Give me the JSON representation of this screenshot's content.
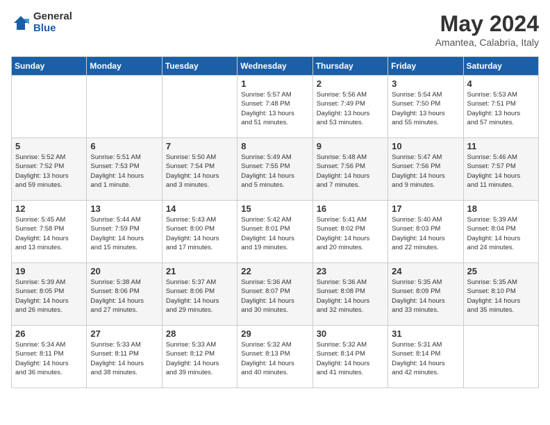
{
  "header": {
    "logo_general": "General",
    "logo_blue": "Blue",
    "title": "May 2024",
    "location": "Amantea, Calabria, Italy"
  },
  "days_of_week": [
    "Sunday",
    "Monday",
    "Tuesday",
    "Wednesday",
    "Thursday",
    "Friday",
    "Saturday"
  ],
  "weeks": [
    [
      {
        "num": "",
        "info": ""
      },
      {
        "num": "",
        "info": ""
      },
      {
        "num": "",
        "info": ""
      },
      {
        "num": "1",
        "info": "Sunrise: 5:57 AM\nSunset: 7:48 PM\nDaylight: 13 hours\nand 51 minutes."
      },
      {
        "num": "2",
        "info": "Sunrise: 5:56 AM\nSunset: 7:49 PM\nDaylight: 13 hours\nand 53 minutes."
      },
      {
        "num": "3",
        "info": "Sunrise: 5:54 AM\nSunset: 7:50 PM\nDaylight: 13 hours\nand 55 minutes."
      },
      {
        "num": "4",
        "info": "Sunrise: 5:53 AM\nSunset: 7:51 PM\nDaylight: 13 hours\nand 57 minutes."
      }
    ],
    [
      {
        "num": "5",
        "info": "Sunrise: 5:52 AM\nSunset: 7:52 PM\nDaylight: 13 hours\nand 59 minutes."
      },
      {
        "num": "6",
        "info": "Sunrise: 5:51 AM\nSunset: 7:53 PM\nDaylight: 14 hours\nand 1 minute."
      },
      {
        "num": "7",
        "info": "Sunrise: 5:50 AM\nSunset: 7:54 PM\nDaylight: 14 hours\nand 3 minutes."
      },
      {
        "num": "8",
        "info": "Sunrise: 5:49 AM\nSunset: 7:55 PM\nDaylight: 14 hours\nand 5 minutes."
      },
      {
        "num": "9",
        "info": "Sunrise: 5:48 AM\nSunset: 7:56 PM\nDaylight: 14 hours\nand 7 minutes."
      },
      {
        "num": "10",
        "info": "Sunrise: 5:47 AM\nSunset: 7:56 PM\nDaylight: 14 hours\nand 9 minutes."
      },
      {
        "num": "11",
        "info": "Sunrise: 5:46 AM\nSunset: 7:57 PM\nDaylight: 14 hours\nand 11 minutes."
      }
    ],
    [
      {
        "num": "12",
        "info": "Sunrise: 5:45 AM\nSunset: 7:58 PM\nDaylight: 14 hours\nand 13 minutes."
      },
      {
        "num": "13",
        "info": "Sunrise: 5:44 AM\nSunset: 7:59 PM\nDaylight: 14 hours\nand 15 minutes."
      },
      {
        "num": "14",
        "info": "Sunrise: 5:43 AM\nSunset: 8:00 PM\nDaylight: 14 hours\nand 17 minutes."
      },
      {
        "num": "15",
        "info": "Sunrise: 5:42 AM\nSunset: 8:01 PM\nDaylight: 14 hours\nand 19 minutes."
      },
      {
        "num": "16",
        "info": "Sunrise: 5:41 AM\nSunset: 8:02 PM\nDaylight: 14 hours\nand 20 minutes."
      },
      {
        "num": "17",
        "info": "Sunrise: 5:40 AM\nSunset: 8:03 PM\nDaylight: 14 hours\nand 22 minutes."
      },
      {
        "num": "18",
        "info": "Sunrise: 5:39 AM\nSunset: 8:04 PM\nDaylight: 14 hours\nand 24 minutes."
      }
    ],
    [
      {
        "num": "19",
        "info": "Sunrise: 5:39 AM\nSunset: 8:05 PM\nDaylight: 14 hours\nand 26 minutes."
      },
      {
        "num": "20",
        "info": "Sunrise: 5:38 AM\nSunset: 8:06 PM\nDaylight: 14 hours\nand 27 minutes."
      },
      {
        "num": "21",
        "info": "Sunrise: 5:37 AM\nSunset: 8:06 PM\nDaylight: 14 hours\nand 29 minutes."
      },
      {
        "num": "22",
        "info": "Sunrise: 5:36 AM\nSunset: 8:07 PM\nDaylight: 14 hours\nand 30 minutes."
      },
      {
        "num": "23",
        "info": "Sunrise: 5:36 AM\nSunset: 8:08 PM\nDaylight: 14 hours\nand 32 minutes."
      },
      {
        "num": "24",
        "info": "Sunrise: 5:35 AM\nSunset: 8:09 PM\nDaylight: 14 hours\nand 33 minutes."
      },
      {
        "num": "25",
        "info": "Sunrise: 5:35 AM\nSunset: 8:10 PM\nDaylight: 14 hours\nand 35 minutes."
      }
    ],
    [
      {
        "num": "26",
        "info": "Sunrise: 5:34 AM\nSunset: 8:11 PM\nDaylight: 14 hours\nand 36 minutes."
      },
      {
        "num": "27",
        "info": "Sunrise: 5:33 AM\nSunset: 8:11 PM\nDaylight: 14 hours\nand 38 minutes."
      },
      {
        "num": "28",
        "info": "Sunrise: 5:33 AM\nSunset: 8:12 PM\nDaylight: 14 hours\nand 39 minutes."
      },
      {
        "num": "29",
        "info": "Sunrise: 5:32 AM\nSunset: 8:13 PM\nDaylight: 14 hours\nand 40 minutes."
      },
      {
        "num": "30",
        "info": "Sunrise: 5:32 AM\nSunset: 8:14 PM\nDaylight: 14 hours\nand 41 minutes."
      },
      {
        "num": "31",
        "info": "Sunrise: 5:31 AM\nSunset: 8:14 PM\nDaylight: 14 hours\nand 42 minutes."
      },
      {
        "num": "",
        "info": ""
      }
    ]
  ]
}
